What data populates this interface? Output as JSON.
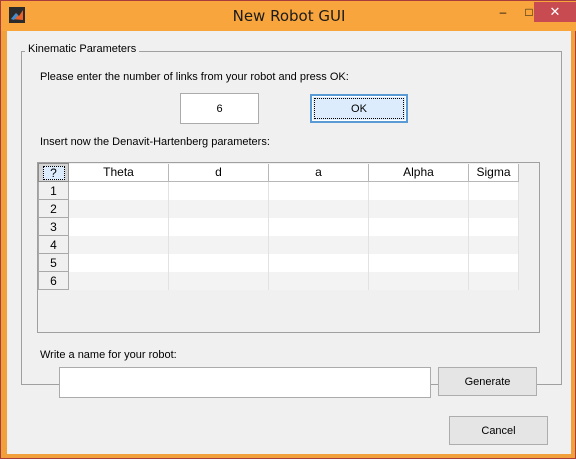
{
  "window": {
    "title": "New Robot GUI",
    "minimize_glyph": "–",
    "maximize_glyph": "□",
    "close_glyph": "✕",
    "app_icon": "matlab-icon"
  },
  "panel": {
    "title": "Kinematic Parameters"
  },
  "links": {
    "prompt": "Please enter the number of links from your robot and press OK:",
    "value": "6",
    "ok_label": "OK"
  },
  "dh": {
    "prompt": "Insert now the Denavit-Hartenberg parameters:",
    "corner_label": "?",
    "columns": [
      "Theta",
      "d",
      "a",
      "Alpha",
      "Sigma"
    ],
    "rows": [
      "1",
      "2",
      "3",
      "4",
      "5",
      "6"
    ]
  },
  "robot_name": {
    "prompt": "Write a name for your robot:",
    "value": "",
    "generate_label": "Generate"
  },
  "footer": {
    "cancel_label": "Cancel"
  },
  "colors": {
    "titlebar": "#f7a53c",
    "close": "#c74b50",
    "accent": "#5b9bd5"
  }
}
